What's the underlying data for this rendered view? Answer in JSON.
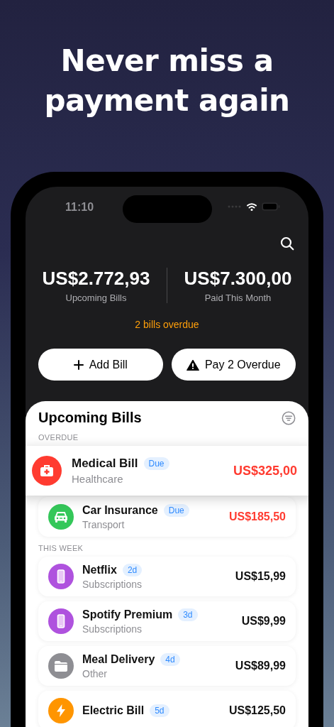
{
  "headline": "Never miss a payment again",
  "status_bar": {
    "time": "11:10"
  },
  "summary": [
    {
      "amount": "US$2.772,93",
      "label": "Upcoming Bills"
    },
    {
      "amount": "US$7.300,00",
      "label": "Paid This Month"
    }
  ],
  "overdue_notice": "2 bills overdue",
  "actions": [
    {
      "label": "Add Bill",
      "kind": "add"
    },
    {
      "label": "Pay 2 Overdue",
      "kind": "warning"
    }
  ],
  "bills_panel": {
    "title": "Upcoming Bills",
    "sections": [
      {
        "heading": "OVERDUE",
        "bills": [
          {
            "name": "Medical Bill",
            "badge": "Due",
            "category": "Healthcare",
            "amount": "US$325,00",
            "overdue": true,
            "lifted": true,
            "kind": "medical",
            "color": "#ff3b30"
          },
          {
            "name": "Car Insurance",
            "badge": "Due",
            "category": "Transport",
            "amount": "US$185,50",
            "overdue": true,
            "lifted": false,
            "kind": "car",
            "color": "#34c759"
          }
        ]
      },
      {
        "heading": "THIS WEEK",
        "bills": [
          {
            "name": "Netflix",
            "badge": "2d",
            "category": "Subscriptions",
            "amount": "US$15,99",
            "overdue": false,
            "lifted": false,
            "kind": "phone",
            "color": "#af52de"
          },
          {
            "name": "Spotify Premium",
            "badge": "3d",
            "category": "Subscriptions",
            "amount": "US$9,99",
            "overdue": false,
            "lifted": false,
            "kind": "phone",
            "color": "#af52de"
          },
          {
            "name": "Meal Delivery",
            "badge": "4d",
            "category": "Other",
            "amount": "US$89,99",
            "overdue": false,
            "lifted": false,
            "kind": "folder",
            "color": "#8e8e93"
          },
          {
            "name": "Electric Bill",
            "badge": "5d",
            "amount": "US$125,50",
            "overdue": false,
            "lifted": false,
            "kind": "bolt",
            "color": "#ff9500"
          }
        ]
      }
    ]
  }
}
